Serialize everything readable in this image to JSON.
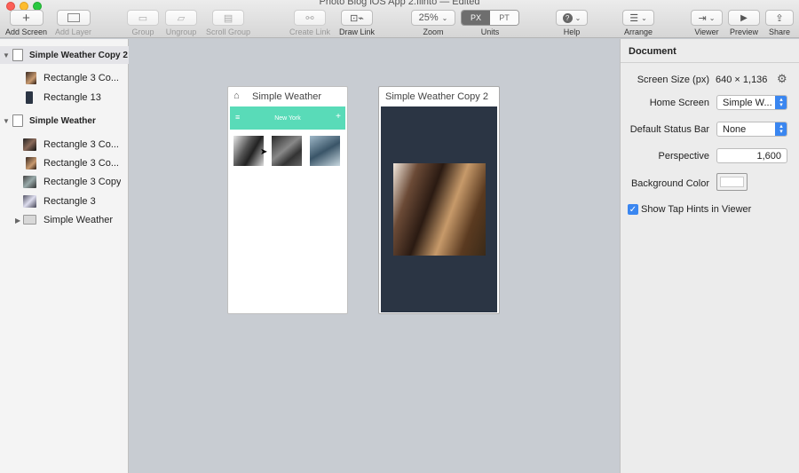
{
  "window": {
    "title": "Photo Blog iOS App 2.flinto — Edited"
  },
  "toolbar": {
    "add_screen": "Add Screen",
    "add_layer": "Add Layer",
    "group": "Group",
    "ungroup": "Ungroup",
    "scroll_group": "Scroll Group",
    "create_link": "Create Link",
    "draw_link": "Draw Link",
    "zoom_value": "25%",
    "zoom_label": "Zoom",
    "units_px": "PX",
    "units_pt": "PT",
    "units_label": "Units",
    "help": "Help",
    "arrange": "Arrange",
    "viewer": "Viewer",
    "preview": "Preview",
    "share": "Share"
  },
  "layers": {
    "screen1": {
      "name": "Simple Weather Copy 2",
      "children": [
        "Rectangle 3 Co...",
        "Rectangle 13"
      ]
    },
    "screen2": {
      "name": "Simple Weather",
      "children": [
        "Rectangle 3 Co...",
        "Rectangle 3 Co...",
        "Rectangle 3 Copy",
        "Rectangle 3"
      ],
      "folder": "Simple Weather"
    }
  },
  "canvas": {
    "artboard1": {
      "title": "Simple Weather",
      "nav_title": "New York"
    },
    "artboard2": {
      "title": "Simple Weather Copy 2"
    }
  },
  "inspector": {
    "header": "Document",
    "screen_size_label": "Screen Size (px)",
    "screen_size_value": "640 × 1,136",
    "home_screen_label": "Home Screen",
    "home_screen_value": "Simple W...",
    "status_bar_label": "Default Status Bar",
    "status_bar_value": "None",
    "perspective_label": "Perspective",
    "perspective_value": "1,600",
    "bg_color_label": "Background Color",
    "tap_hints_label": "Show Tap Hints in Viewer"
  },
  "colors": {
    "accent": "#3a86f0",
    "nav_bar": "#59dbb8",
    "dark_screen": "#2b3544"
  }
}
